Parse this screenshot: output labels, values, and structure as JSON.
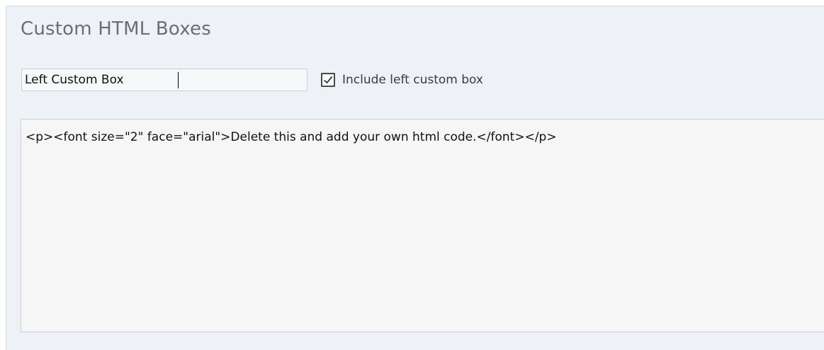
{
  "section": {
    "title": "Custom HTML Boxes"
  },
  "box_name": {
    "value": "Left Custom Box"
  },
  "include_option": {
    "label": "Include left custom box",
    "checked": true,
    "check_icon": "checkmark-icon"
  },
  "html_code": {
    "value": "<p><font size=\"2\" face=\"arial\">Delete this and add your own html code.</font></p>"
  },
  "colors": {
    "panel_background": "#eef2f7",
    "title_text": "#6b6f74",
    "field_border": "#c9ced5"
  }
}
